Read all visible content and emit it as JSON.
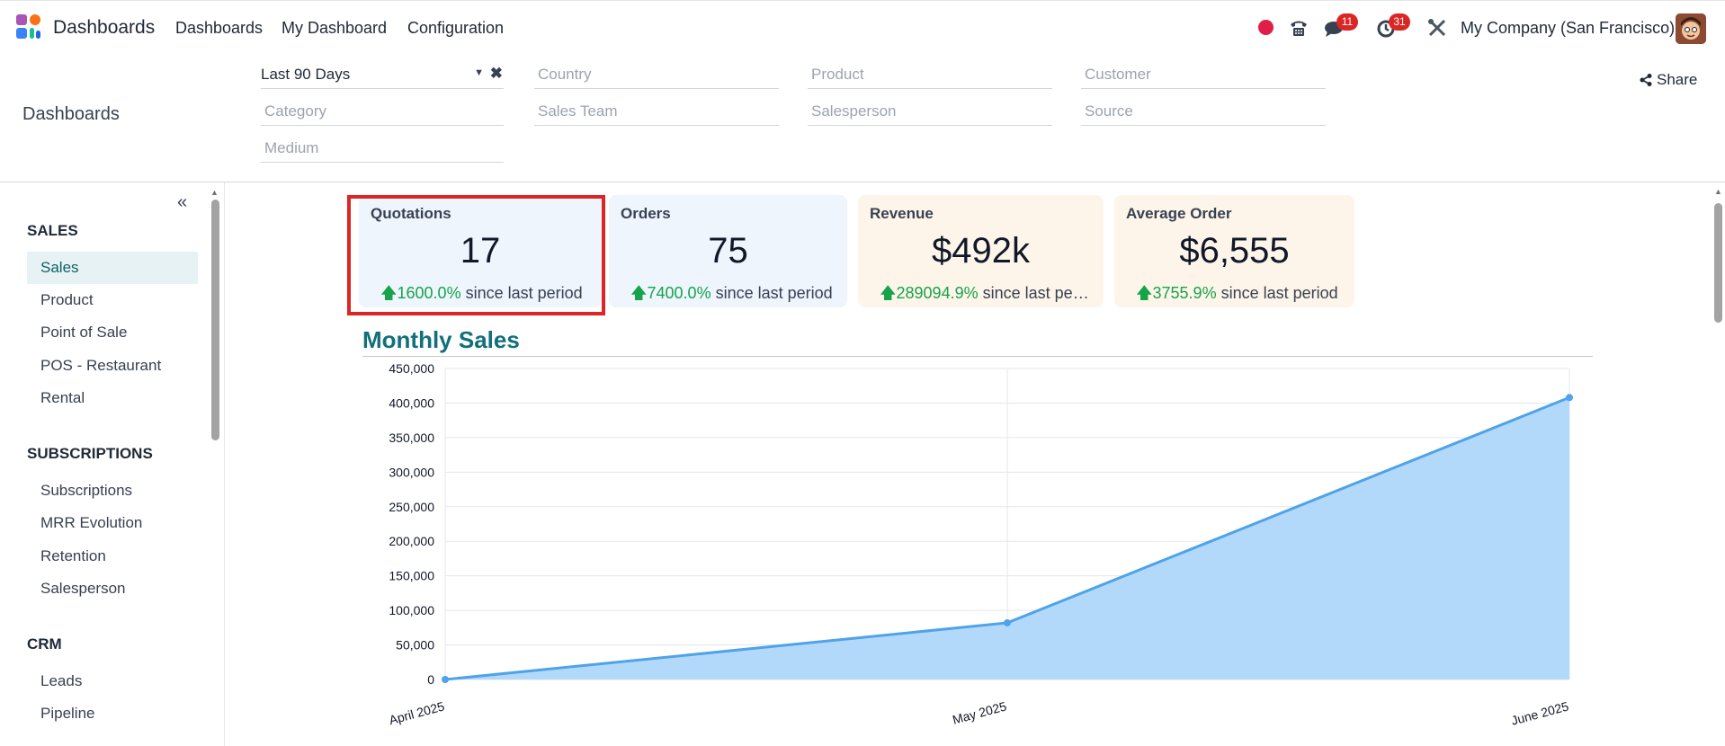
{
  "navbar": {
    "app_name": "Dashboards",
    "menu": [
      "Dashboards",
      "My Dashboard",
      "Configuration"
    ],
    "messages_badge": "11",
    "activities_badge": "31",
    "company": "My Company (San Francisco)"
  },
  "control_panel": {
    "title": "Dashboards",
    "date_filter": "Last 90 Days",
    "filters": {
      "country": "Country",
      "product": "Product",
      "customer": "Customer",
      "category": "Category",
      "sales_team": "Sales Team",
      "salesperson": "Salesperson",
      "source": "Source",
      "medium": "Medium"
    },
    "share_label": "Share"
  },
  "sidebar": {
    "collapse_icon": "«",
    "sections": [
      {
        "title": "SALES",
        "items": [
          "Sales",
          "Product",
          "Point of Sale",
          "POS - Restaurant",
          "Rental"
        ]
      },
      {
        "title": "SUBSCRIPTIONS",
        "items": [
          "Subscriptions",
          "MRR Evolution",
          "Retention",
          "Salesperson"
        ]
      },
      {
        "title": "CRM",
        "items": [
          "Leads",
          "Pipeline"
        ]
      }
    ],
    "active_item": "Sales"
  },
  "kpis": [
    {
      "title": "Quotations",
      "value": "17",
      "delta": "1600.0%",
      "delta_text": "since last period",
      "bg": "#eef5fd"
    },
    {
      "title": "Orders",
      "value": "75",
      "delta": "7400.0%",
      "delta_text": "since last period",
      "bg": "#eef5fd"
    },
    {
      "title": "Revenue",
      "value": "$492k",
      "delta": "289094.9%",
      "delta_text": "since last period",
      "bg": "#fef5ea"
    },
    {
      "title": "Average Order",
      "value": "$6,555",
      "delta": "3755.9%",
      "delta_text": "since last period",
      "bg": "#fef5ea"
    }
  ],
  "chart_data": {
    "type": "area",
    "title": "Monthly Sales",
    "categories": [
      "April 2025",
      "May 2025",
      "June 2025"
    ],
    "values": [
      0,
      82000,
      408000
    ],
    "ylim": [
      0,
      450000
    ],
    "yticks": [
      0,
      50000,
      100000,
      150000,
      200000,
      250000,
      300000,
      350000,
      400000,
      450000
    ],
    "ytick_labels": [
      "0",
      "50,000",
      "100,000",
      "150,000",
      "200,000",
      "250,000",
      "300,000",
      "350,000",
      "400,000",
      "450,000"
    ],
    "grid": true,
    "line_color": "#4fa3e8",
    "fill_color": "#b3d9fa"
  },
  "colors": {
    "accent": "#11707c",
    "positive": "#16a34a",
    "highlight": "#dc2626",
    "badge": "#dc2626"
  }
}
